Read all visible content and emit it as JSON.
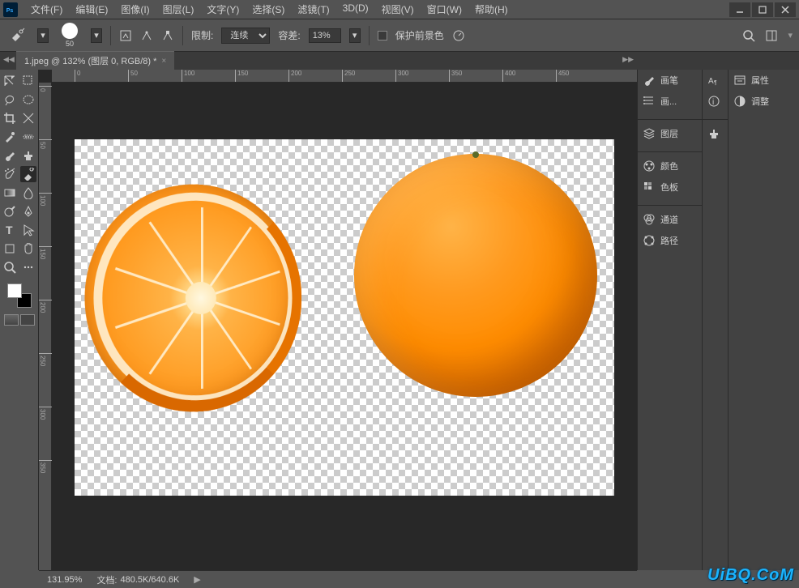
{
  "menubar": {
    "items": [
      "文件(F)",
      "编辑(E)",
      "图像(I)",
      "图层(L)",
      "文字(Y)",
      "选择(S)",
      "滤镜(T)",
      "3D(D)",
      "视图(V)",
      "窗口(W)",
      "帮助(H)"
    ]
  },
  "options": {
    "brush_size": "50",
    "limit_label": "限制:",
    "limit_value": "连续",
    "tolerance_label": "容差:",
    "tolerance_value": "13%",
    "protect_fg_label": "保护前景色"
  },
  "tab": {
    "title": "1.jpeg @ 132% (图层 0, RGB/8) *"
  },
  "ruler_h": [
    "0",
    "50",
    "100",
    "150",
    "200",
    "250",
    "300",
    "350",
    "400",
    "450"
  ],
  "ruler_v": [
    "0",
    "50",
    "100",
    "150",
    "200",
    "250",
    "300",
    "350"
  ],
  "panelsA": [
    {
      "icon": "brush",
      "label": "画笔"
    },
    {
      "icon": "brush-preset",
      "label": "画..."
    },
    {
      "gap": true
    },
    {
      "icon": "layers",
      "label": "图层"
    },
    {
      "gap": true
    },
    {
      "icon": "color",
      "label": "颜色"
    },
    {
      "icon": "swatches",
      "label": "色板"
    },
    {
      "gap": true
    },
    {
      "icon": "channels",
      "label": "通道"
    },
    {
      "icon": "paths",
      "label": "路径"
    }
  ],
  "panelsB": [
    {
      "icon": "char"
    },
    {
      "icon": "info"
    },
    {
      "gap": true
    },
    {
      "icon": "stamp"
    }
  ],
  "panelsC": [
    {
      "icon": "properties",
      "label": "属性"
    },
    {
      "icon": "adjustments",
      "label": "调整"
    }
  ],
  "colors": {
    "fg": "#ffffff",
    "bg": "#000000"
  },
  "status": {
    "zoom": "131.95%",
    "doc_label": "文档:",
    "doc_size": "480.5K/640.6K"
  },
  "watermark": "UiBQ.CoM"
}
